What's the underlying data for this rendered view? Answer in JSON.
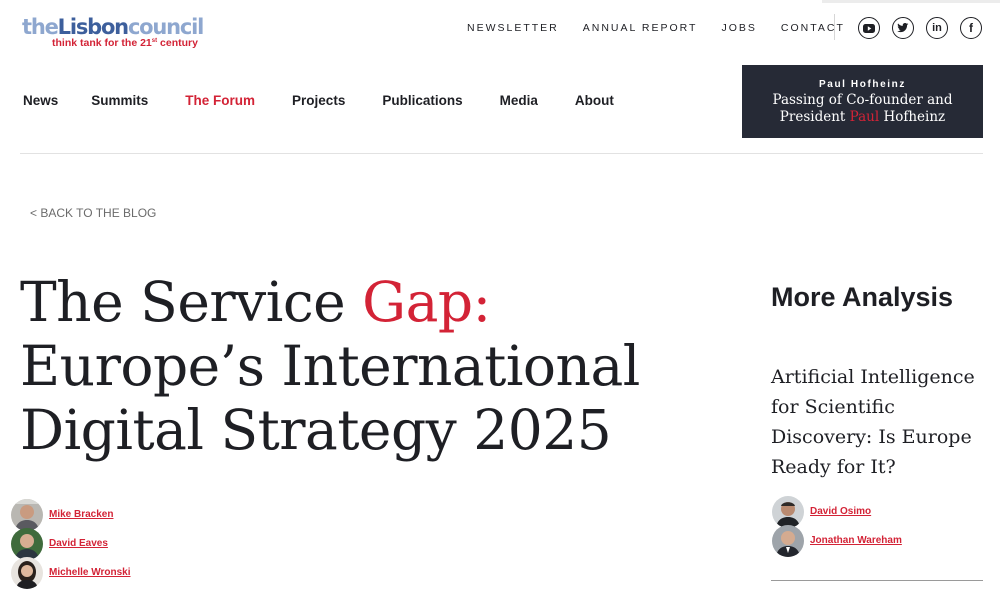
{
  "logo": {
    "the": "the",
    "lisbon": "Lisbon",
    "council": "council",
    "tagline_before": "think tank for the 21",
    "tagline_sup": "st",
    "tagline_after": " century"
  },
  "top_nav": [
    "NEWSLETTER",
    "ANNUAL REPORT",
    "JOBS",
    "CONTACT"
  ],
  "social_icons": [
    "youtube-icon",
    "twitter-icon",
    "linkedin-icon",
    "facebook-icon"
  ],
  "main_nav": {
    "items": [
      "News",
      "Summits",
      "The Forum",
      "Projects",
      "Publications",
      "Media",
      "About"
    ],
    "active": "The Forum",
    "active_color": "#d32336"
  },
  "banner": {
    "name": "Paul Hofheinz",
    "headline_part1": "Passing of Co-founder and",
    "headline_part2": "President",
    "headline_highlight": "Paul",
    "headline_part3": "Hofheinz"
  },
  "back_link": "< BACK TO THE BLOG",
  "article": {
    "title_part1": "The Service",
    "title_highlight": "Gap:",
    "title_part2": "Europe’s International Digital Strategy 2025",
    "authors": [
      "Mike Bracken",
      "David Eaves",
      "Michelle Wronski"
    ]
  },
  "sidebar": {
    "heading": "More Analysis",
    "article_title": "Artificial Intelligence for Scientific Discovery: Is Europe Ready for It?",
    "authors": [
      "David Osimo",
      "Jonathan Wareham"
    ]
  },
  "colors": {
    "accent_red": "#d32336",
    "dark_navy": "#262a36",
    "logo_blue": "#3d5f9c",
    "logo_light_blue": "#8ea7cf"
  }
}
